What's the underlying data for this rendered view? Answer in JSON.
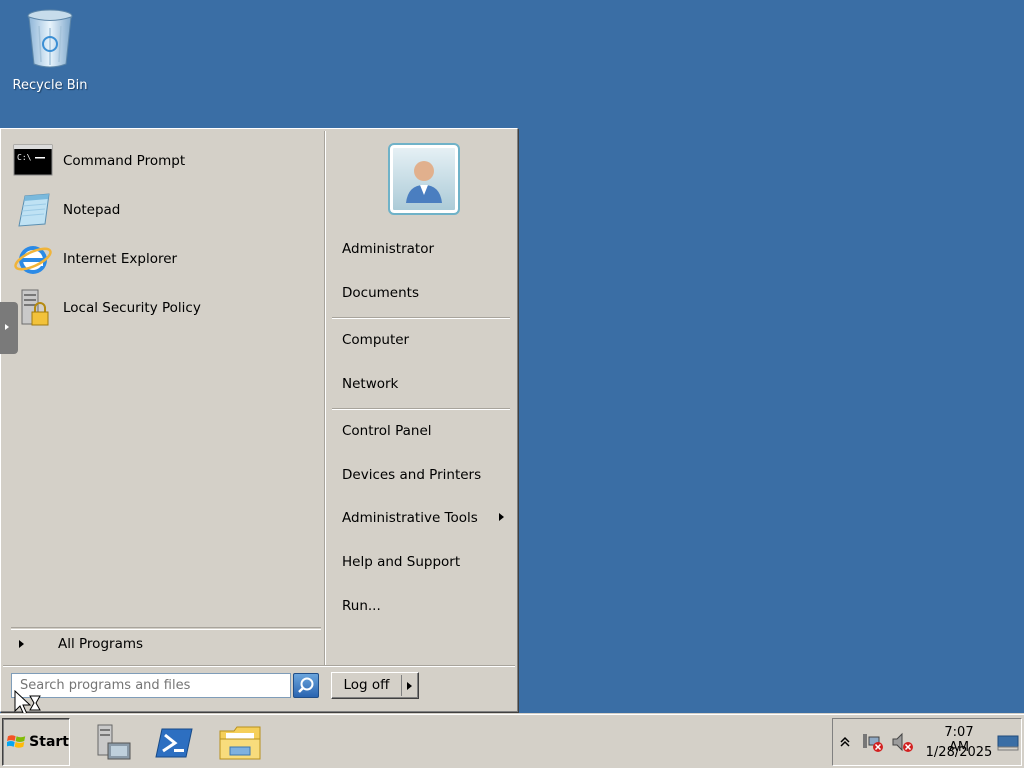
{
  "desktop": {
    "recycle_bin_label": "Recycle Bin",
    "background_color": "#3a6ea5"
  },
  "start_menu": {
    "pinned": [
      {
        "label": "Command Prompt",
        "icon": "command-prompt-icon"
      },
      {
        "label": "Notepad",
        "icon": "notepad-icon"
      },
      {
        "label": "Internet Explorer",
        "icon": "internet-explorer-icon"
      },
      {
        "label": "Local Security Policy",
        "icon": "security-policy-icon"
      }
    ],
    "all_programs_label": "All Programs",
    "right": {
      "user": "Administrator",
      "documents": "Documents",
      "computer": "Computer",
      "network": "Network",
      "control_panel": "Control Panel",
      "devices_printers": "Devices and Printers",
      "admin_tools": "Administrative Tools",
      "help_support": "Help and Support",
      "run": "Run..."
    },
    "search_placeholder": "Search programs and files",
    "logoff_label": "Log off"
  },
  "taskbar": {
    "start_label": "Start",
    "apps": [
      "server-manager-icon",
      "powershell-icon",
      "file-explorer-icon"
    ],
    "tray": {
      "time": "7:07 AM",
      "date": "1/28/2025",
      "icons": [
        "show-hidden-icons-chevron",
        "network-disconnected-icon",
        "volume-muted-icon",
        "show-desktop-icon"
      ]
    }
  }
}
